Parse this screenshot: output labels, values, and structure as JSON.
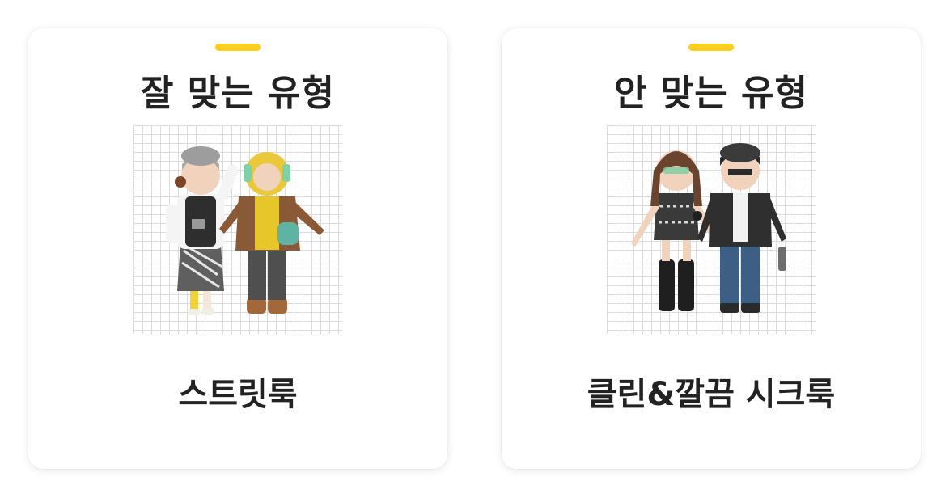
{
  "accent_color": "#FFCF1F",
  "cards": [
    {
      "title": "잘 맞는 유형",
      "label": "스트릿룩",
      "image": "street-look-figures"
    },
    {
      "title": "안 맞는 유형",
      "label": "클린&깔끔 시크룩",
      "image": "clean-chic-look-figures"
    }
  ]
}
